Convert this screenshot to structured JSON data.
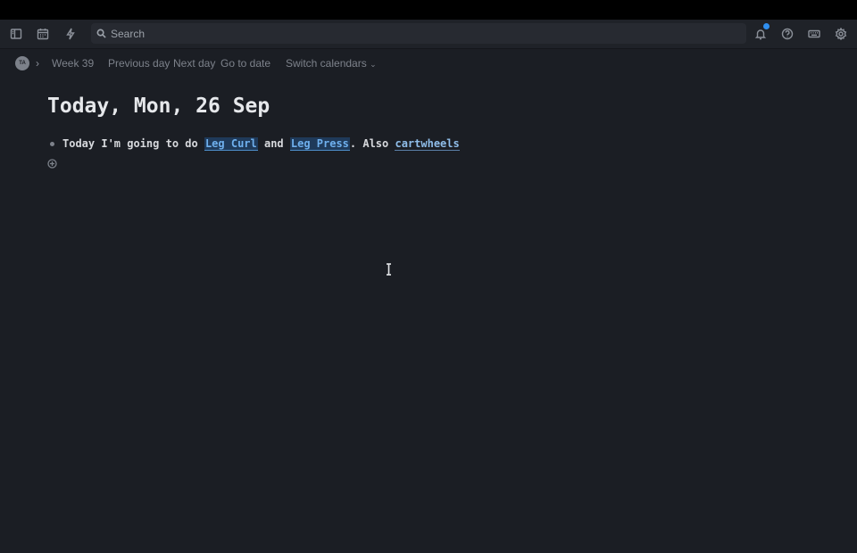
{
  "topbar": {
    "search": {
      "placeholder": "Search"
    },
    "icons": [
      "sidebar-toggle-icon",
      "calendar-icon",
      "lightning-icon",
      "bell-icon",
      "help-icon",
      "keyboard-icon",
      "settings-icon"
    ],
    "notification_dot_color": "#2f8ff0"
  },
  "nav": {
    "avatar_initials": "TA",
    "week": "Week 39",
    "previous_day": "Previous day",
    "next_day": "Next day",
    "go_to_date": "Go to date",
    "switch_calendars": "Switch calendars"
  },
  "page": {
    "title": "Today, Mon, 26 Sep",
    "block": {
      "text_1": "Today I'm going to do ",
      "ref_1": "Leg Curl",
      "text_2": " and ",
      "ref_2": "Leg Press",
      "text_3": ". Also ",
      "ref_3": "cartwheels"
    }
  },
  "colors": {
    "background": "#1b1e24",
    "topbar": "#1f2228",
    "reference_highlight": "#1f3a5a",
    "reference_text": "#6fb0ee"
  }
}
